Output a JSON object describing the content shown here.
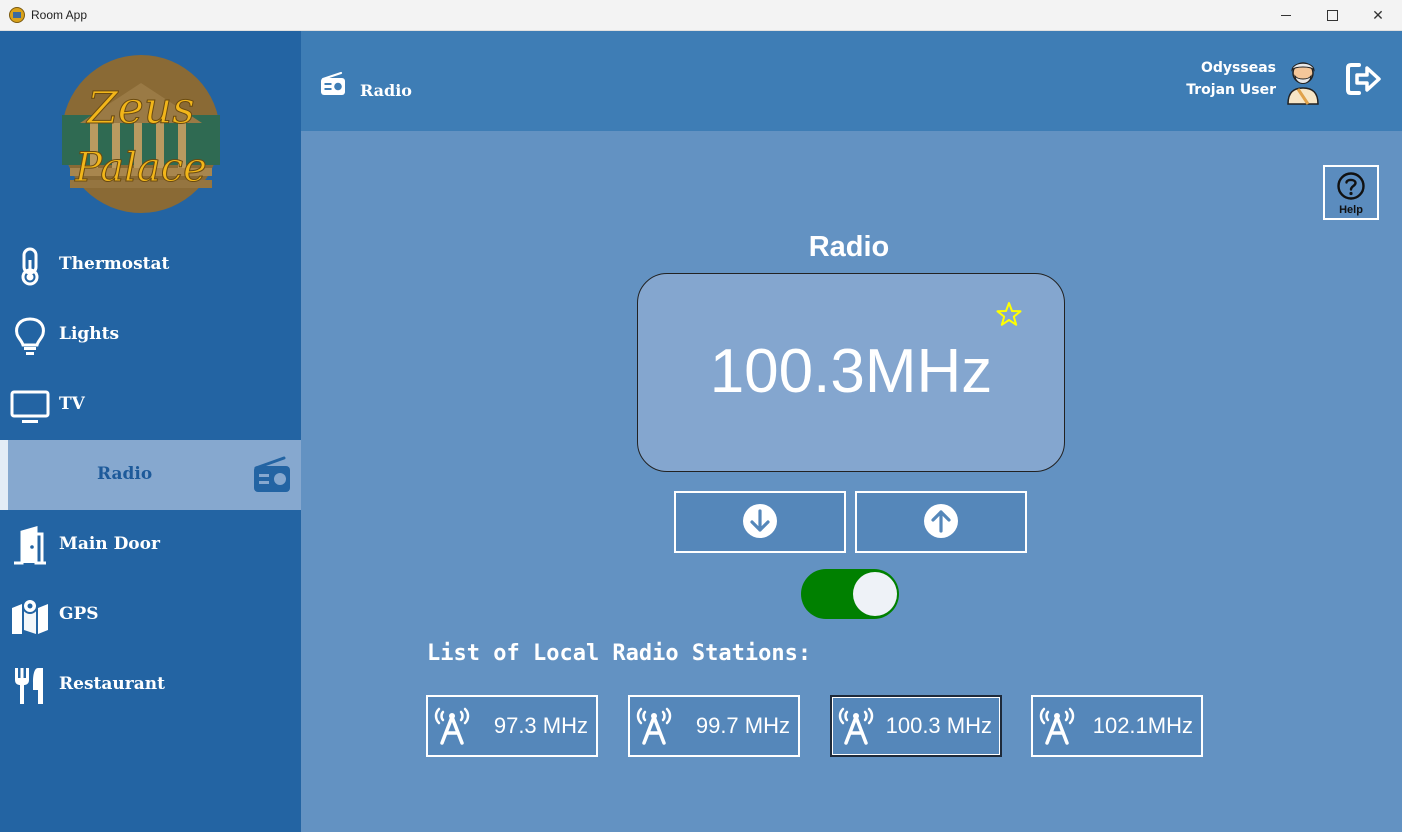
{
  "window": {
    "title": "Room App"
  },
  "sidebar": {
    "logo_text": [
      "Zeus",
      "Palace"
    ],
    "items": [
      {
        "label": "Thermostat",
        "icon": "thermometer-icon"
      },
      {
        "label": "Lights",
        "icon": "lightbulb-icon"
      },
      {
        "label": "TV",
        "icon": "tv-icon"
      },
      {
        "label": "Radio",
        "icon": "radio-icon",
        "active": true
      },
      {
        "label": "Main Door",
        "icon": "door-icon"
      },
      {
        "label": "GPS",
        "icon": "map-icon"
      },
      {
        "label": "Restaurant",
        "icon": "utensils-icon"
      }
    ]
  },
  "header": {
    "title": "Radio",
    "user": {
      "name": "Odysseas",
      "role": "Trojan User"
    }
  },
  "main": {
    "help_label": "Help",
    "title": "Radio",
    "frequency": "100.3MHz",
    "favorite": false,
    "power_on": true,
    "stations_title": "List of Local Radio Stations:",
    "stations": [
      "97.3 MHz",
      "99.7 MHz",
      "100.3 MHz",
      "102.1MHz"
    ],
    "selected_station_index": 2
  },
  "colors": {
    "sidebar": "#2364a3",
    "topbar": "#3e7db5",
    "content": "#6392c2",
    "active_item": "#86a8cf",
    "toggle_on": "#008000",
    "star": "#ffff00"
  }
}
